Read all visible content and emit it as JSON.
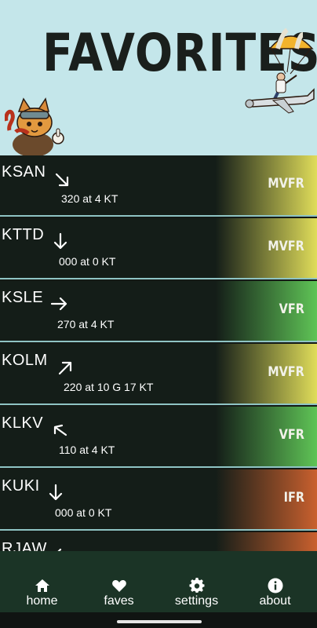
{
  "header": {
    "title": "FAVORITES"
  },
  "colors": {
    "header_bg": "#c4e6ea",
    "row_bg": "#141d18",
    "mvfr": "#e0dd5a",
    "vfr": "#5fc456",
    "ifr": "#c9602e",
    "divider": "#8fc4c4",
    "nav_bg": "#1b3426"
  },
  "favorites": [
    {
      "id": "KSAN",
      "wind": "320 at 4 KT",
      "category": "MVFR",
      "arrow_icon": "arrow-down-right-icon"
    },
    {
      "id": "KTTD",
      "wind": "000 at 0 KT",
      "category": "MVFR",
      "arrow_icon": "arrow-down-icon"
    },
    {
      "id": "KSLE",
      "wind": "270 at 4 KT",
      "category": "VFR",
      "arrow_icon": "arrow-right-icon"
    },
    {
      "id": "KOLM",
      "wind": "220 at 10 G 17 KT",
      "category": "MVFR",
      "arrow_icon": "arrow-up-right-icon"
    },
    {
      "id": "KLKV",
      "wind": "110 at 4 KT",
      "category": "VFR",
      "arrow_icon": "arrow-up-left-icon"
    },
    {
      "id": "KUKI",
      "wind": "000 at 0 KT",
      "category": "IFR",
      "arrow_icon": "arrow-down-icon"
    },
    {
      "id": "RJAW",
      "wind": "",
      "category": "",
      "arrow_icon": "arrow-left-icon"
    }
  ],
  "nav": {
    "items": [
      {
        "label": "home",
        "icon": "home-icon"
      },
      {
        "label": "faves",
        "icon": "heart-icon"
      },
      {
        "label": "settings",
        "icon": "gear-icon"
      },
      {
        "label": "about",
        "icon": "info-icon"
      }
    ]
  }
}
